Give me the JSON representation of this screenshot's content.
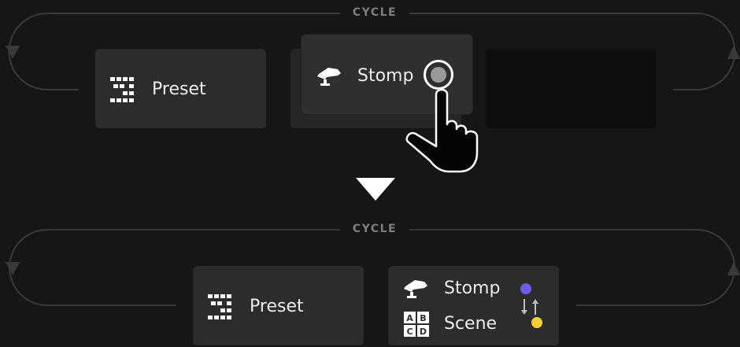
{
  "top": {
    "cycle_label": "CYCLE",
    "cards": {
      "preset": {
        "label": "Preset",
        "icon": "preset-blocks-icon"
      },
      "stomp": {
        "label": "Stomp",
        "icon": "stomp-pedal-icon"
      },
      "empty": {
        "label": ""
      }
    },
    "pointer": {
      "icon": "hand-pointer-icon"
    }
  },
  "divider": {
    "icon": "down-triangle-icon"
  },
  "bottom": {
    "cycle_label": "CYCLE",
    "cards": {
      "preset": {
        "label": "Preset",
        "icon": "preset-blocks-icon"
      },
      "combo": {
        "stomp_label": "Stomp",
        "scene_label": "Scene",
        "icons": [
          "stomp-pedal-icon",
          "abcd-scene-icon",
          "swap-arrows-icon"
        ]
      }
    }
  },
  "colors": {
    "background": "#161616",
    "card": "#2c2c2c",
    "empty_card": "#0e0e0e",
    "stomp_dot": "#6c5ce7",
    "scene_dot": "#f5d033",
    "cycle_line": "#3a3a3a"
  }
}
